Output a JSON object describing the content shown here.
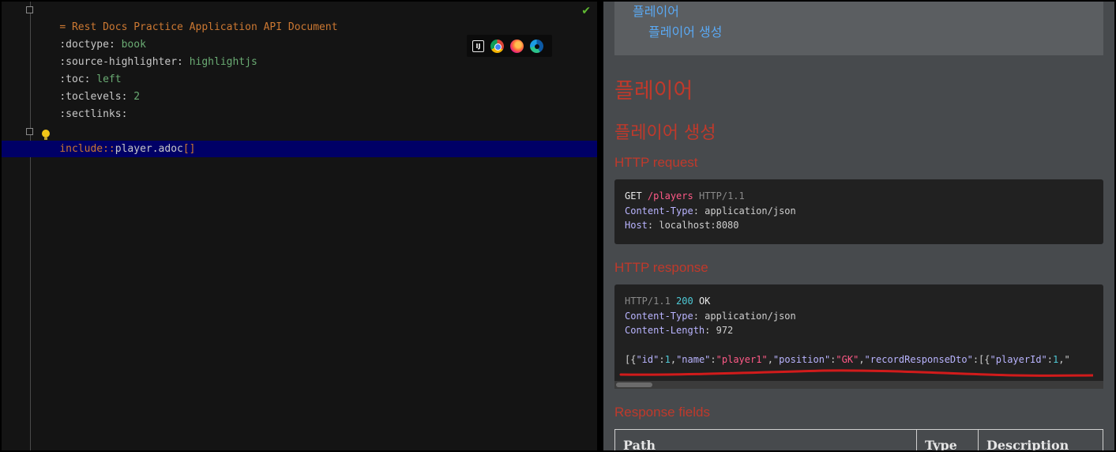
{
  "editor": {
    "lines": {
      "l1_prefix": "= ",
      "l1_title": "Rest Docs Practice Application API Document",
      "l2_attr": ":doctype",
      "l2_sep": ": ",
      "l2_val": "book",
      "l3_attr": ":source-highlighter",
      "l3_sep": ": ",
      "l3_val": "highlightjs",
      "l4_attr": ":toc",
      "l4_sep": ": ",
      "l4_val": "left",
      "l5_attr": ":toclevels",
      "l5_sep": ": ",
      "l5_val": "2",
      "l6_attr": ":sectlinks",
      "l6_sep": ":",
      "l8_i": "i",
      "l8_kw": "nclude::",
      "l8_file": "player.adoc",
      "l8_brackets": "[]"
    },
    "check": "✔",
    "browser_icons": [
      "intellij-icon",
      "chrome-icon",
      "firefox-icon",
      "edge-icon"
    ],
    "ij_label": "IJ"
  },
  "preview": {
    "toc": {
      "item1": "플레이어",
      "item2": "플레이어 생성"
    },
    "h1": "플레이어",
    "h2": "플레이어 생성",
    "http_request_title": "HTTP request",
    "request": {
      "method": "GET",
      "path": "/players",
      "proto": "HTTP/1.1",
      "h1_name": "Content-Type",
      "h1_val": "application/json",
      "h2_name": "Host",
      "h2_val": "localhost:8080"
    },
    "http_response_title": "HTTP response",
    "response": {
      "proto": "HTTP/1.1",
      "status": "200",
      "status_text": "OK",
      "h1_name": "Content-Type",
      "h1_val": "application/json",
      "h2_name": "Content-Length",
      "h2_val": "972",
      "body": {
        "p1": "[{",
        "k_id": "\"id\"",
        "colon1": ":",
        "v_id": "1",
        "p2": ",",
        "k_name": "\"name\"",
        "colon2": ":",
        "v_name": "\"player1\"",
        "p3": ",",
        "k_pos": "\"position\"",
        "colon3": ":",
        "v_pos": "\"GK\"",
        "p4": ",",
        "k_rec": "\"recordResponseDto\"",
        "colon4": ":[{",
        "k_pid": "\"playerId\"",
        "colon5": ":",
        "v_pid": "1",
        "p5": ",\""
      }
    },
    "response_fields_title": "Response fields",
    "table_headers": [
      "Path",
      "Type",
      "Description"
    ]
  }
}
